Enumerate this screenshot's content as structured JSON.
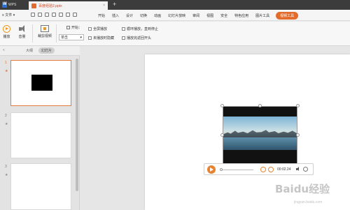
{
  "titlebar": {
    "app_name": "WPS",
    "doc_tab": "百度经验2.pptx",
    "close": "×",
    "add_tab": "+"
  },
  "menubar": {
    "file_label": "≡ 文件 ▾",
    "items": [
      "开始",
      "插入",
      "设计",
      "切换",
      "动画",
      "幻灯片放映",
      "审阅",
      "视图",
      "安全",
      "特色应用",
      "图片工具",
      "视频工具"
    ],
    "active_index": 11
  },
  "ribbon": {
    "play_label": "播放",
    "volume_label": "音量",
    "clip_label": "裁剪视频",
    "start_label": "开始：",
    "start_value": "单击",
    "checkboxes": {
      "fullscreen": "全屏播放",
      "hide_when_not_playing": "未播放时隐藏",
      "loop": "循环播放，直到停止",
      "rewind": "播放完返回开头"
    }
  },
  "leftpane": {
    "collapse": "«",
    "tab_outline": "大纲",
    "tab_slides": "幻灯片",
    "slides": [
      {
        "num": "1",
        "star": "★"
      },
      {
        "num": "2",
        "star": "★"
      },
      {
        "num": "3",
        "star": "★"
      }
    ]
  },
  "player": {
    "time": "00:02.24"
  },
  "watermark": {
    "text": "Baidu经验",
    "sub": "jingyan.baidu.com"
  },
  "colors": {
    "accent": "#e36b2c",
    "titlebar": "#3c3c3c"
  }
}
